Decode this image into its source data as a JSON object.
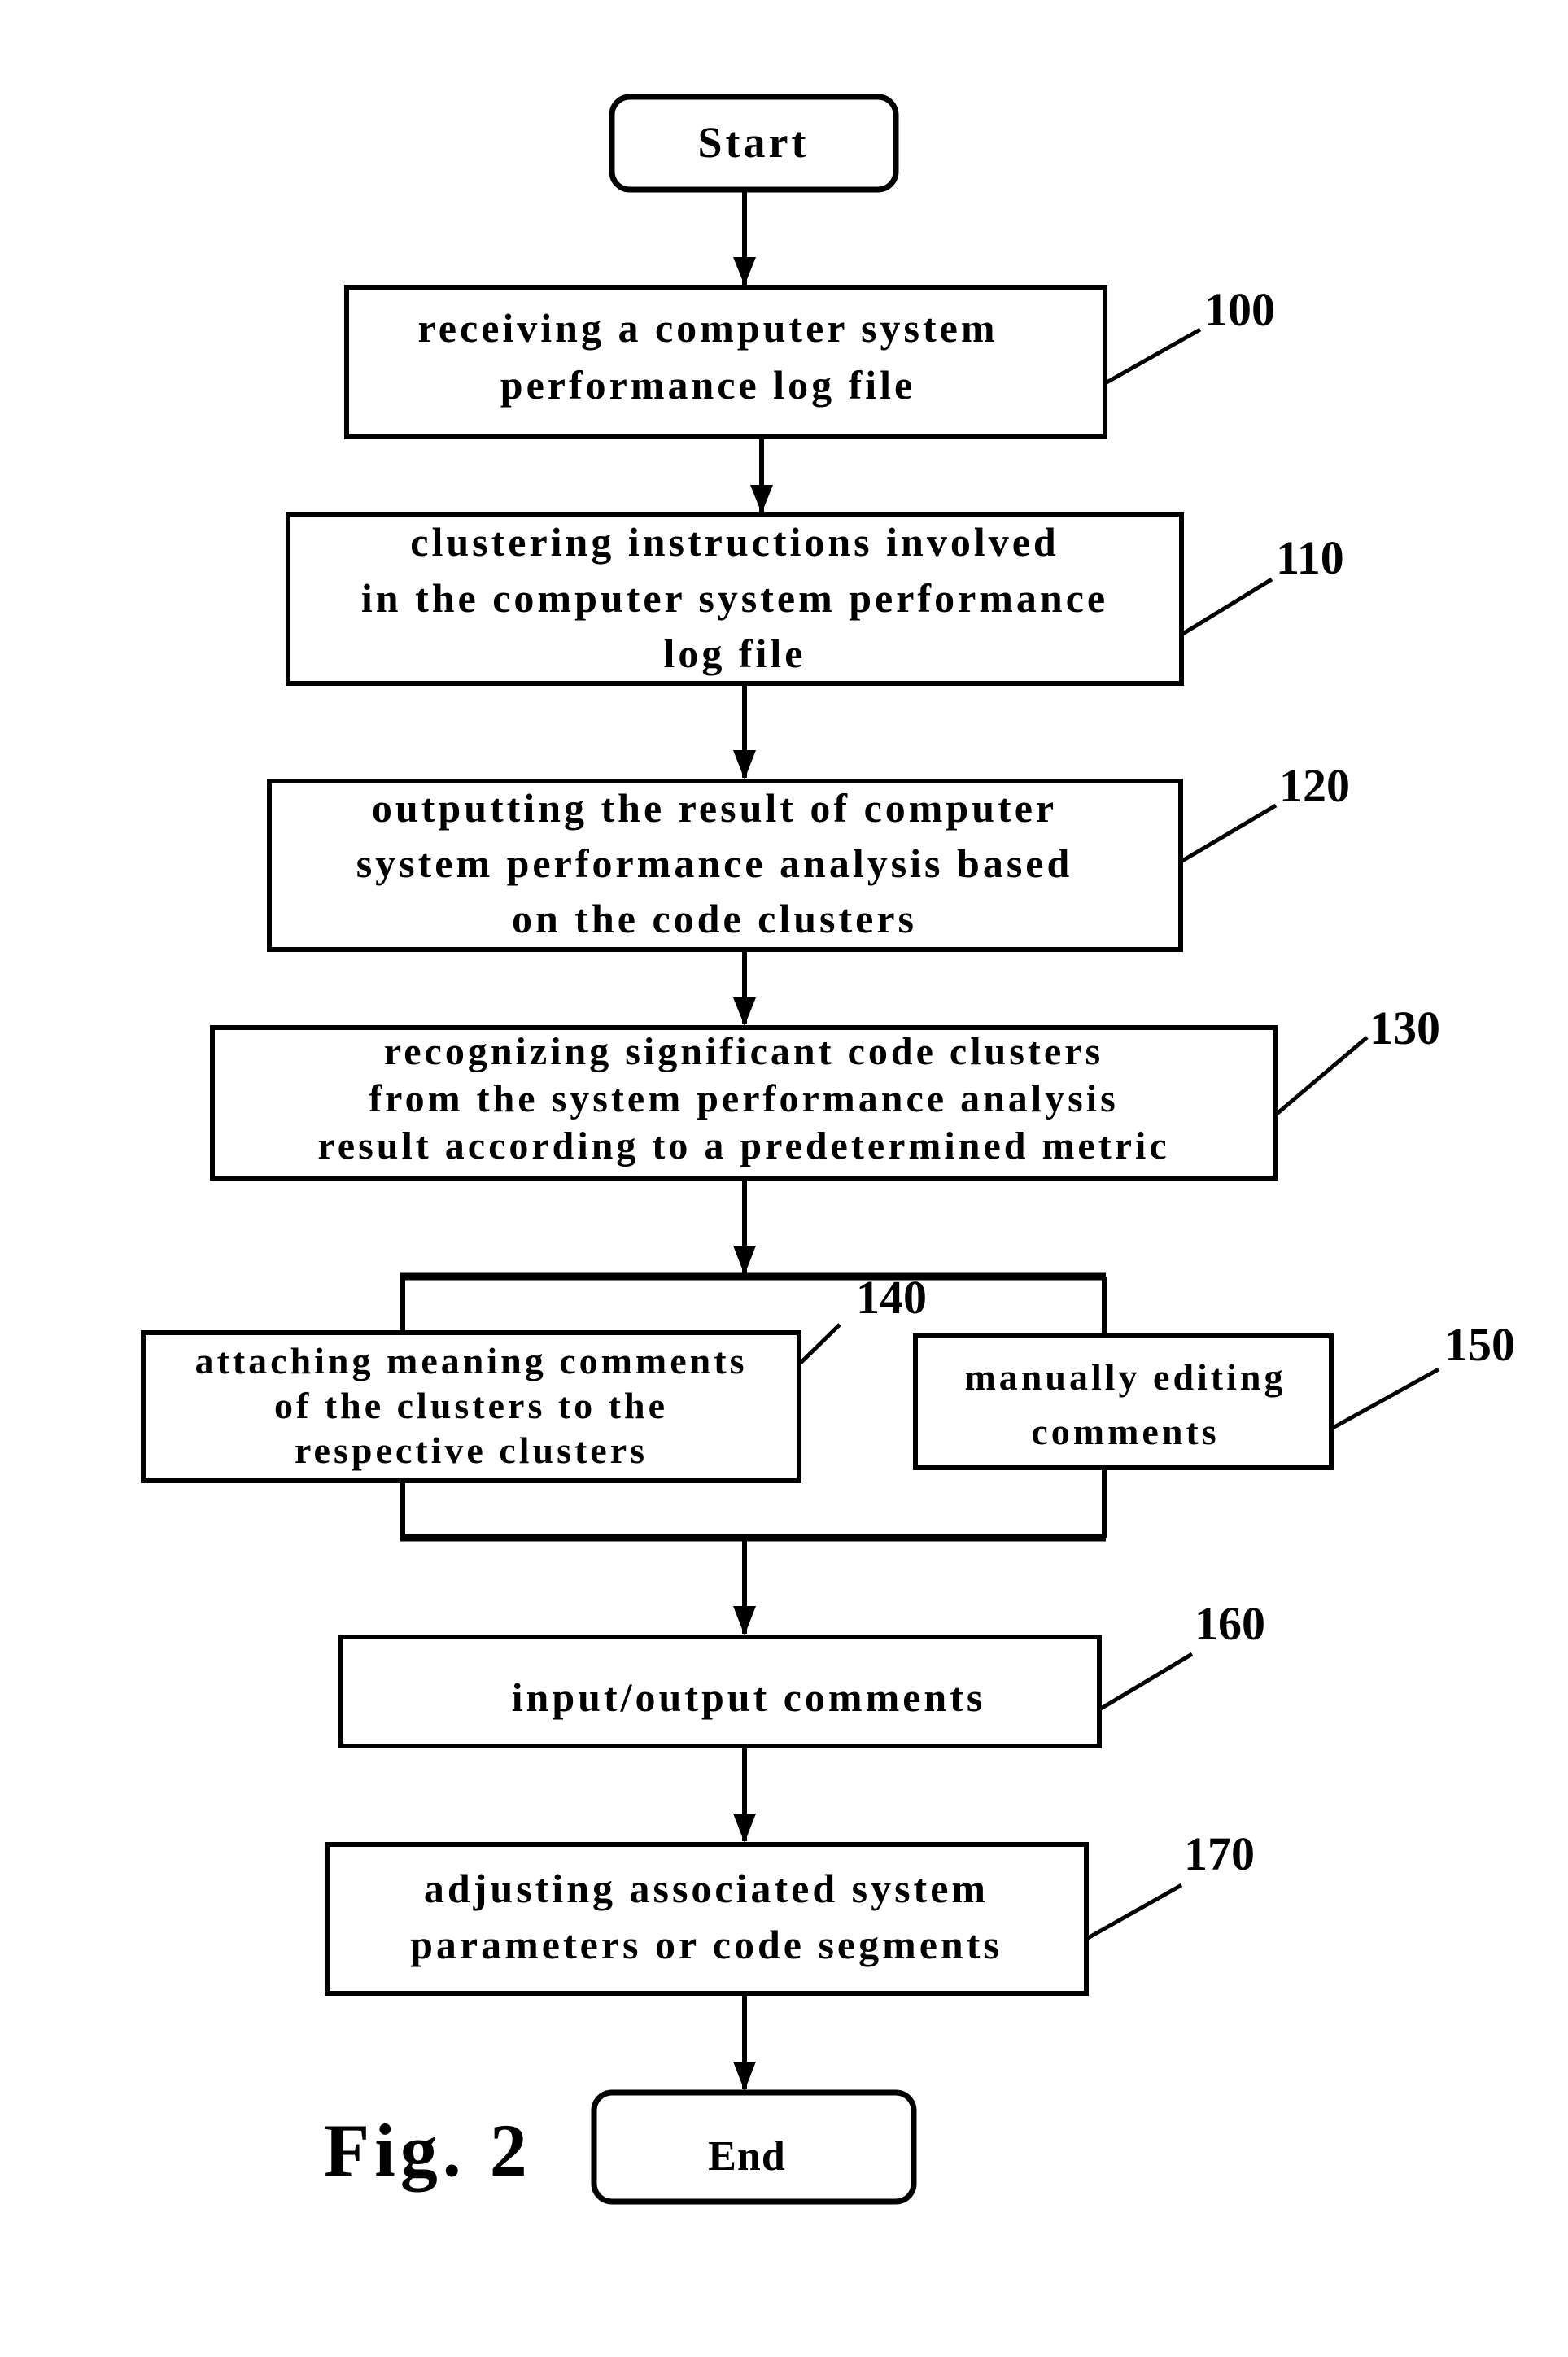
{
  "figure_label": "Fig. 2",
  "colors": {
    "stroke": "#000000",
    "background": "#ffffff"
  },
  "start": {
    "label": "Start"
  },
  "end": {
    "label": "End"
  },
  "steps": [
    {
      "ref": "100",
      "lines": [
        "receiving a computer system",
        "performance log file"
      ]
    },
    {
      "ref": "110",
      "lines": [
        "clustering instructions involved",
        "in the computer system performance",
        "log file"
      ]
    },
    {
      "ref": "120",
      "lines": [
        "outputting the result of computer",
        "system performance analysis based",
        "on the code clusters"
      ]
    },
    {
      "ref": "130",
      "lines": [
        "recognizing significant code clusters",
        "from the system performance analysis",
        "result according to a predetermined metric"
      ]
    },
    {
      "ref": "140",
      "lines": [
        "attaching meaning comments",
        "of the clusters to the",
        "respective clusters"
      ]
    },
    {
      "ref": "150",
      "lines": [
        "manually editing",
        "comments"
      ]
    },
    {
      "ref": "160",
      "lines": [
        "input/output comments"
      ]
    },
    {
      "ref": "170",
      "lines": [
        "adjusting associated system",
        "parameters or code segments"
      ]
    }
  ]
}
